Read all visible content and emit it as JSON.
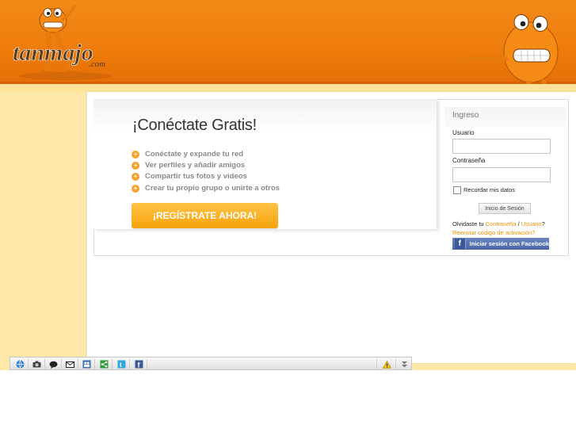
{
  "brand": {
    "logo_text": "tanmajo",
    "logo_suffix": ".com"
  },
  "promo": {
    "title": "¡Conéctate Gratis!",
    "features": [
      "Conéctate y expande tu red",
      "Ver perfiles y añadir amigos",
      "Compartir tus fotos y videos",
      "Crear tu propio grupo o unirte a otros"
    ],
    "register_label": "¡REGÍSTRATE AHORA!"
  },
  "login": {
    "title": "Ingreso",
    "username_label": "Usuario",
    "password_label": "Contraseña",
    "username_value": "",
    "password_value": "",
    "remember_label": "Recordar mis datos",
    "signin_label": "Inicio de Sesión",
    "forgot_prefix": "Olvidaste tu",
    "forgot_password": "Contraseña",
    "forgot_separator": "/",
    "forgot_username": "Usuario",
    "forgot_suffix": "?",
    "resend_label": "Reenviar código de activación?",
    "facebook_label": "Iniciar sesión con Facebook"
  },
  "toolbar": {
    "icons": [
      "globe-icon",
      "camera-icon",
      "chat-icon",
      "mail-icon",
      "group-icon",
      "share-icon",
      "twitter-icon",
      "facebook-icon",
      "warning-icon",
      "collapse-icon"
    ]
  },
  "colors": {
    "header_orange": "#ee7c0c",
    "page_yellow": "#fde8a8",
    "button_orange": "#f6a20d",
    "link_orange": "#f39200",
    "facebook_blue": "#4b66a6"
  }
}
